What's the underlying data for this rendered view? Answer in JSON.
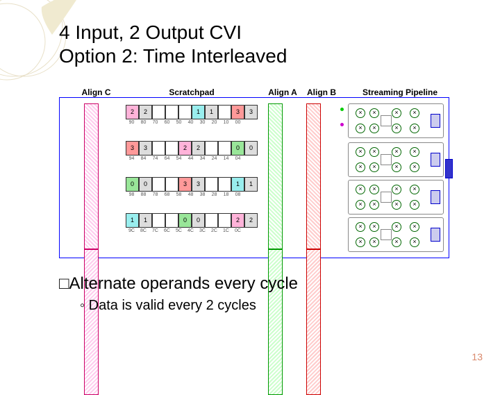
{
  "title_l1": "4 Input, 2 Output CVI",
  "title_l2": "Option 2: Time Interleaved",
  "headers": {
    "alignc": "Align C",
    "scratch": "Scratchpad",
    "aligna": "Align A",
    "alignb": "Align B",
    "pipe": "Streaming Pipeline"
  },
  "rows": [
    {
      "cells": [
        "2",
        "2",
        "",
        "",
        "",
        "1",
        "1",
        "",
        "3",
        "3"
      ],
      "colors": [
        "c-pink",
        "c-gray",
        "",
        "",
        "",
        "c-cyan",
        "c-gray",
        "",
        "c-red",
        "c-gray"
      ],
      "labels": [
        "90",
        "80",
        "70",
        "60",
        "50",
        "40",
        "30",
        "20",
        "10",
        "00"
      ]
    },
    {
      "cells": [
        "3",
        "3",
        "",
        "",
        "2",
        "2",
        "",
        "",
        "0",
        "0"
      ],
      "colors": [
        "c-red",
        "c-gray",
        "",
        "",
        "c-pink",
        "c-gray",
        "",
        "",
        "c-green",
        "c-gray"
      ],
      "labels": [
        "94",
        "84",
        "74",
        "64",
        "54",
        "44",
        "34",
        "24",
        "14",
        "04"
      ]
    },
    {
      "cells": [
        "0",
        "0",
        "",
        "",
        "3",
        "3",
        "",
        "",
        "1",
        "1"
      ],
      "colors": [
        "c-green",
        "c-gray",
        "",
        "",
        "c-red",
        "c-gray",
        "",
        "",
        "c-cyan",
        "c-gray"
      ],
      "labels": [
        "98",
        "88",
        "78",
        "68",
        "58",
        "48",
        "38",
        "28",
        "18",
        "08"
      ]
    },
    {
      "cells": [
        "1",
        "1",
        "",
        "",
        "0",
        "0",
        "",
        "",
        "2",
        "2"
      ],
      "colors": [
        "c-cyan",
        "c-gray",
        "",
        "",
        "c-green",
        "c-gray",
        "",
        "",
        "c-pink",
        "c-gray"
      ],
      "labels": [
        "9C",
        "8C",
        "7C",
        "6C",
        "5C",
        "4C",
        "3C",
        "2C",
        "1C",
        "0C"
      ]
    }
  ],
  "bullet1": "Alternate operands every cycle",
  "bullet2": "Data is valid every 2 cycles",
  "page": "13"
}
